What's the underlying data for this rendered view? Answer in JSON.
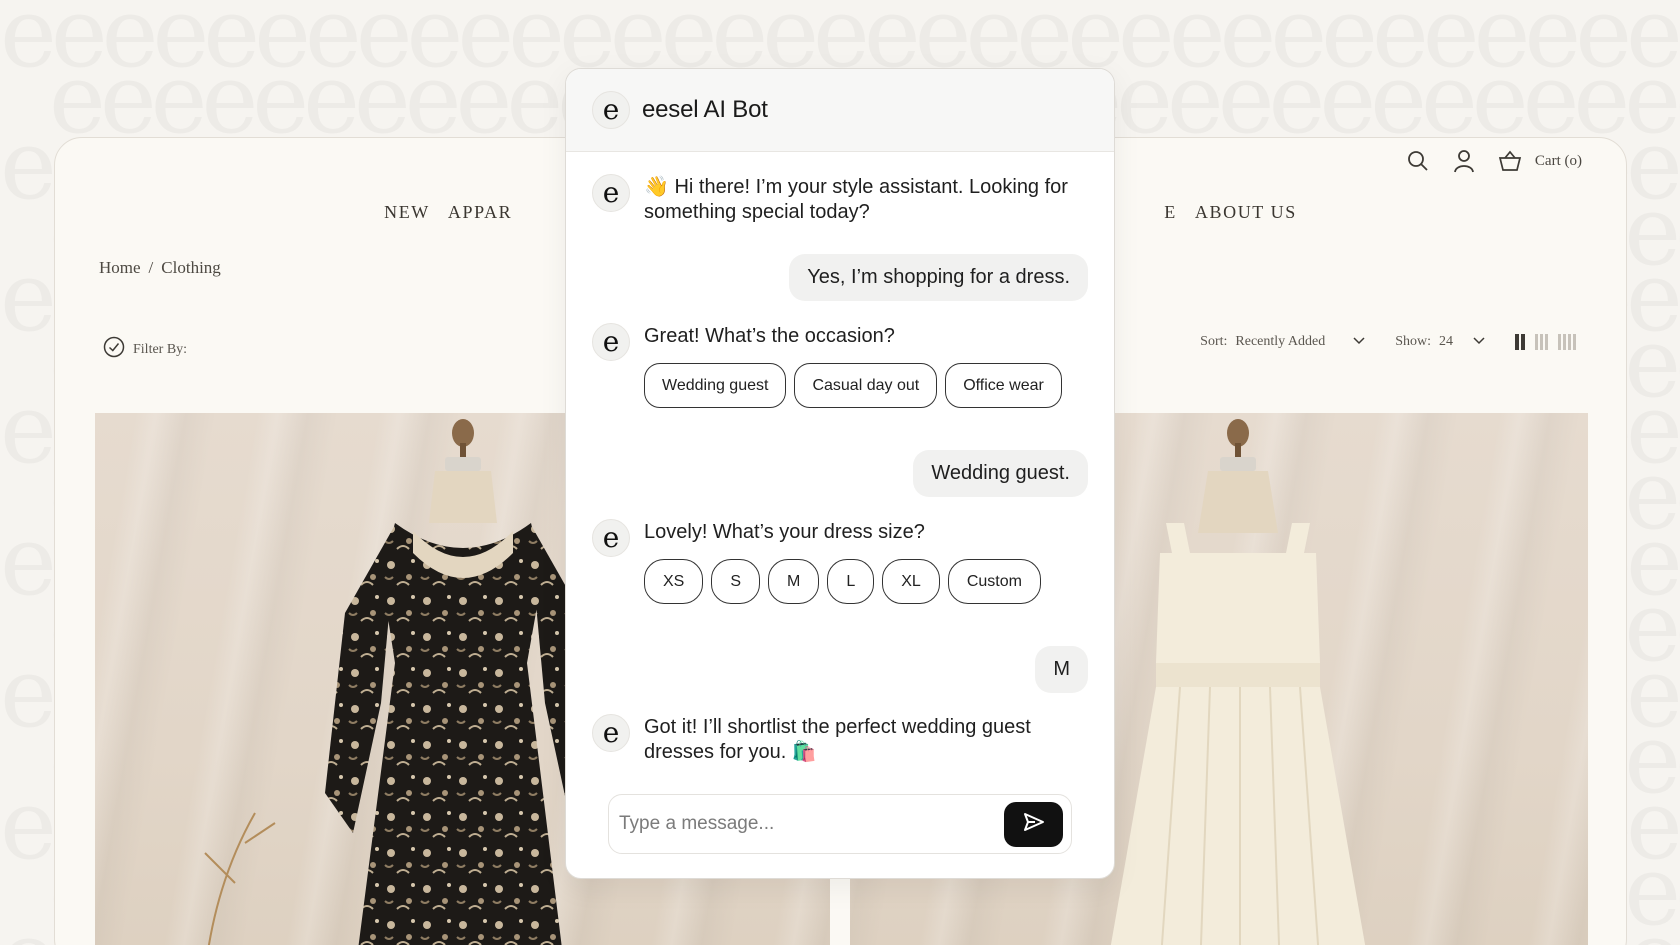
{
  "store": {
    "nav": [
      "NEW",
      "APPAR",
      "E",
      "ABOUT US"
    ],
    "cart_label": "Cart (o)",
    "breadcrumb": {
      "home": "Home",
      "separator": "/",
      "current": "Clothing"
    },
    "filter_label": "Filter By:",
    "sort_label": "Sort:",
    "sort_value": "Recently Added",
    "show_label": "Show:",
    "show_value": "24",
    "icons": [
      "search-icon",
      "user-icon",
      "basket-icon",
      "check-circle-icon",
      "chevron-down-icon",
      "grid-layout-icon"
    ]
  },
  "chat": {
    "title": "eesel AI Bot",
    "avatar_glyph": "e",
    "messages": {
      "m1": "👋 Hi there! I’m your style assistant. Looking for something special today?",
      "u1": "Yes, I’m shopping for a dress.",
      "m2": "Great! What’s the occasion?",
      "occasion_options": [
        "Wedding guest",
        "Casual day out",
        "Office wear"
      ],
      "u2": "Wedding guest.",
      "m3": "Lovely! What’s your dress size?",
      "size_options": [
        "XS",
        "S",
        "M",
        "L",
        "XL",
        "Custom"
      ],
      "u3": "M",
      "m4": "Got it! I’ll shortlist the perfect wedding guest dresses for you. 🛍️"
    },
    "input_placeholder": "Type a message...",
    "send_icon": "send-icon"
  },
  "colors": {
    "page_bg": "#f6f4f0",
    "store_bg": "#fbf9f4",
    "send_button": "#111111",
    "dress_dark": "#1d1a17",
    "dress_light": "#f3ecdb"
  }
}
